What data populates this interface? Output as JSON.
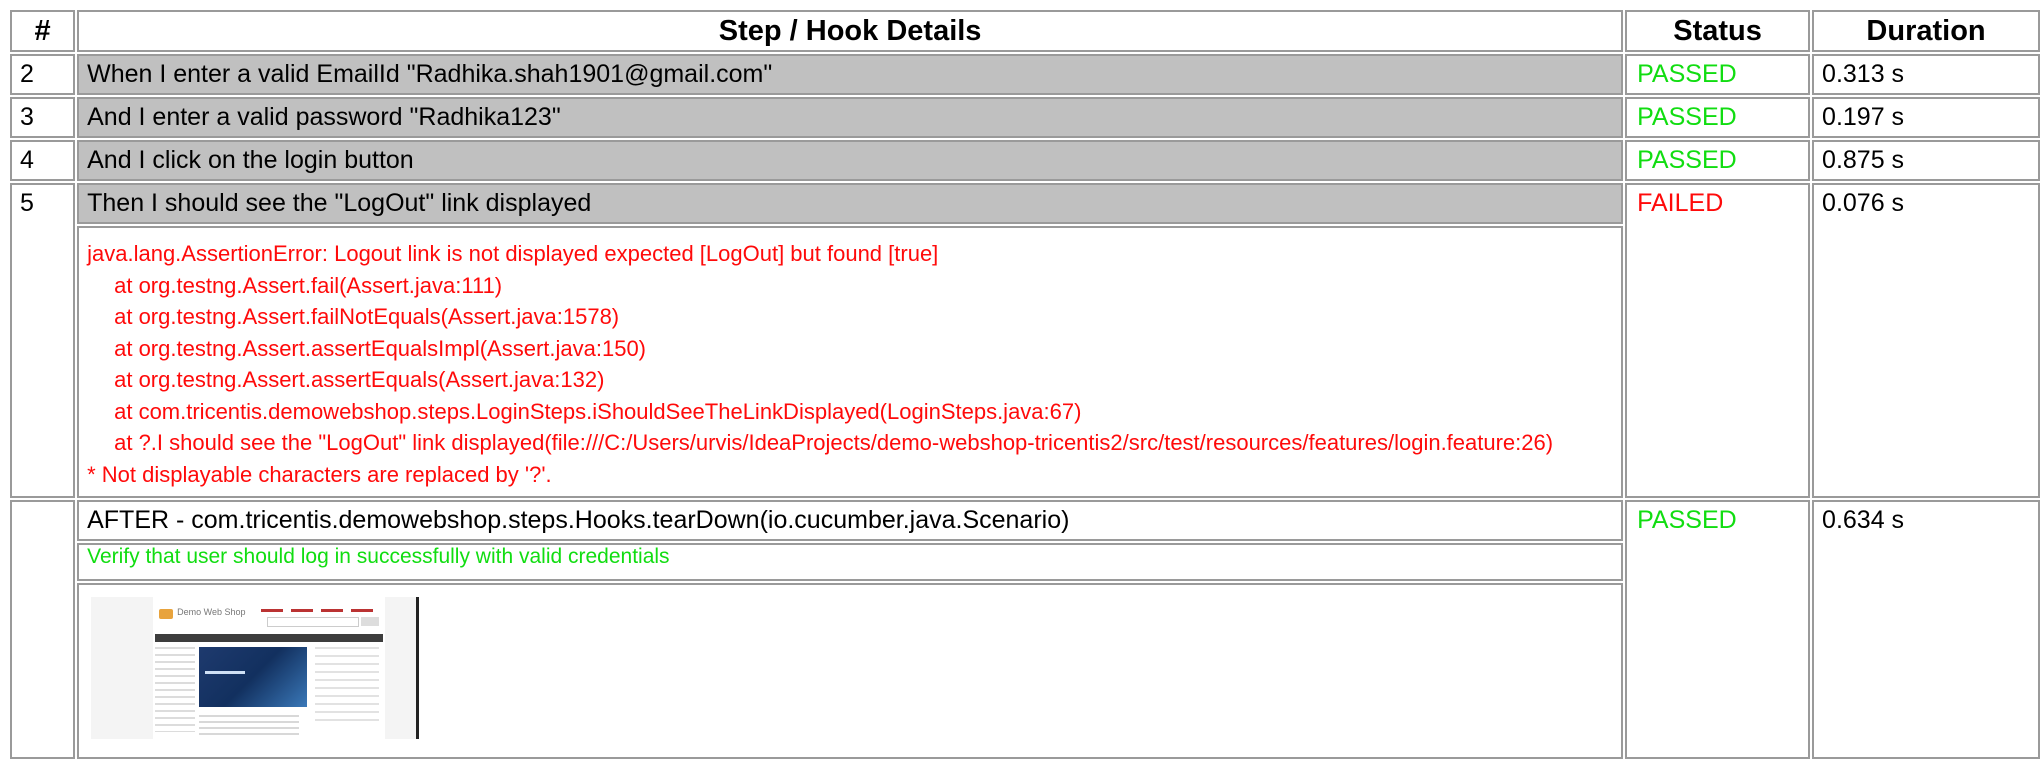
{
  "headers": {
    "num": "#",
    "details": "Step / Hook Details",
    "status": "Status",
    "duration": "Duration"
  },
  "steps": [
    {
      "num": "2",
      "text": "When I enter a valid EmailId \"Radhika.shah1901@gmail.com\"",
      "status": "PASSED",
      "duration": "0.313 s"
    },
    {
      "num": "3",
      "text": "And I enter a valid password \"Radhika123\"",
      "status": "PASSED",
      "duration": "0.197 s"
    },
    {
      "num": "4",
      "text": "And I click on the login button",
      "status": "PASSED",
      "duration": "0.875 s"
    },
    {
      "num": "5",
      "text": "Then I should see the \"LogOut\" link displayed",
      "status": "FAILED",
      "duration": "0.076 s"
    }
  ],
  "error": {
    "message": "java.lang.AssertionError: Logout link is not displayed expected [LogOut] but found [true]",
    "trace": [
      "at org.testng.Assert.fail(Assert.java:111)",
      "at org.testng.Assert.failNotEquals(Assert.java:1578)",
      "at org.testng.Assert.assertEqualsImpl(Assert.java:150)",
      "at org.testng.Assert.assertEquals(Assert.java:132)",
      "at com.tricentis.demowebshop.steps.LoginSteps.iShouldSeeTheLinkDisplayed(LoginSteps.java:67)",
      "at ?.I should see the \"LogOut\" link displayed(file:///C:/Users/urvis/IdeaProjects/demo-webshop-tricentis2/src/test/resources/features/login.feature:26)"
    ],
    "note": "* Not displayable characters are replaced by '?'."
  },
  "hook": {
    "text": "AFTER - com.tricentis.demowebshop.steps.Hooks.tearDown(io.cucumber.java.Scenario)",
    "status": "PASSED",
    "duration": "0.634 s",
    "description": "Verify that user should log in successfully with valid credentials",
    "screenshot": {
      "logo_text": "Demo Web Shop"
    }
  },
  "colors": {
    "passed": "#11dd11",
    "failed": "#ff0a0a",
    "step_background": "#c0c0c0",
    "border": "#9a9a9a"
  }
}
